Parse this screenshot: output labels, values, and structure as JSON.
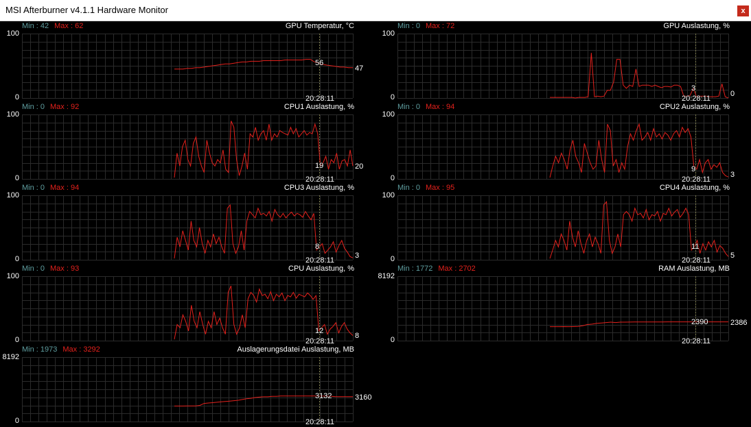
{
  "window": {
    "title": "MSI Afterburner v4.1.1 Hardware Monitor",
    "close_label": "x"
  },
  "colors": {
    "line": "#e4211c",
    "grid": "#2b2b2b",
    "min": "#5f9ea0",
    "max": "#e4211c",
    "cursor": "#7a7a4a"
  },
  "panels": [
    {
      "id": "gpu-temp",
      "title": "GPU Temperatur, °C",
      "min_label": "Min : 42",
      "max_label": "Max : 62",
      "y_top": "100",
      "y_bottom": "0",
      "ymax": 100,
      "cursor_value": "56",
      "current_value": "47",
      "time": "20:28:11"
    },
    {
      "id": "gpu-usage",
      "title": "GPU Auslastung, %",
      "min_label": "Min : 0",
      "max_label": "Max : 72",
      "y_top": "100",
      "y_bottom": "0",
      "ymax": 100,
      "cursor_value": "3",
      "current_value": "0",
      "time": "20:28:11"
    },
    {
      "id": "cpu1-usage",
      "title": "CPU1 Auslastung, %",
      "min_label": "Min : 0",
      "max_label": "Max : 92",
      "y_top": "100",
      "y_bottom": "0",
      "ymax": 100,
      "cursor_value": "19",
      "current_value": "20",
      "time": "20:28:11"
    },
    {
      "id": "cpu2-usage",
      "title": "CPU2 Auslastung, %",
      "min_label": "Min : 0",
      "max_label": "Max : 94",
      "y_top": "100",
      "y_bottom": "0",
      "ymax": 100,
      "cursor_value": "9",
      "current_value": "3",
      "time": "20:28:11"
    },
    {
      "id": "cpu3-usage",
      "title": "CPU3 Auslastung, %",
      "min_label": "Min : 0",
      "max_label": "Max : 94",
      "y_top": "100",
      "y_bottom": "0",
      "ymax": 100,
      "cursor_value": "8",
      "current_value": "3",
      "time": "20:28:11"
    },
    {
      "id": "cpu4-usage",
      "title": "CPU4 Auslastung, %",
      "min_label": "Min : 0",
      "max_label": "Max : 95",
      "y_top": "100",
      "y_bottom": "0",
      "ymax": 100,
      "cursor_value": "11",
      "current_value": "5",
      "time": "20:28:11"
    },
    {
      "id": "cpu-usage",
      "title": "CPU Auslastung, %",
      "min_label": "Min : 0",
      "max_label": "Max : 93",
      "y_top": "100",
      "y_bottom": "0",
      "ymax": 100,
      "cursor_value": "12",
      "current_value": "8",
      "time": "20:28:11"
    },
    {
      "id": "ram-usage",
      "title": "RAM Auslastung, MB",
      "min_label": "Min : 1772",
      "max_label": "Max : 2702",
      "y_top": "8192",
      "y_bottom": "0",
      "ymax": 8192,
      "cursor_value": "2390",
      "current_value": "2386",
      "time": "20:28:11"
    },
    {
      "id": "pagefile-usage",
      "title": "Auslagerungsdatei Auslastung, MB",
      "min_label": "Min : 1973",
      "max_label": "Max : 3292",
      "y_top": "8192",
      "y_bottom": "0",
      "ymax": 8192,
      "cursor_value": "3132",
      "current_value": "3160",
      "time": "20:28:11"
    }
  ],
  "chart_data": [
    {
      "type": "line",
      "title": "GPU Temperatur, °C",
      "ylim": [
        0,
        100
      ],
      "series": [
        {
          "values": [
            45,
            45,
            45,
            46,
            46,
            47,
            47,
            48,
            49,
            50,
            51,
            52,
            53,
            53,
            54,
            55,
            56,
            56,
            57,
            57,
            57,
            58,
            58,
            58,
            58,
            58,
            59,
            59,
            59,
            59,
            59,
            60,
            60,
            56,
            54,
            52,
            51,
            50,
            49,
            48,
            48,
            47,
            47
          ]
        }
      ]
    },
    {
      "type": "line",
      "title": "GPU Auslastung, %",
      "ylim": [
        0,
        100
      ],
      "series": [
        {
          "values": [
            1,
            1,
            1,
            1,
            1,
            1,
            1,
            1,
            0,
            1,
            1,
            1,
            2,
            70,
            2,
            3,
            2,
            3,
            12,
            12,
            25,
            60,
            60,
            20,
            15,
            20,
            18,
            45,
            18,
            20,
            20,
            20,
            18,
            20,
            18,
            16,
            18,
            18,
            17,
            20,
            20,
            18,
            3,
            3,
            4,
            15,
            2,
            3,
            3,
            3,
            2,
            2,
            2,
            3,
            22,
            2,
            0
          ]
        }
      ]
    },
    {
      "type": "line",
      "title": "CPU1 Auslastung, %",
      "ylim": [
        0,
        100
      ],
      "series": [
        {
          "values": [
            2,
            40,
            20,
            50,
            60,
            30,
            20,
            55,
            65,
            35,
            20,
            10,
            60,
            40,
            25,
            20,
            30,
            25,
            45,
            15,
            10,
            90,
            80,
            30,
            5,
            20,
            40,
            15,
            70,
            65,
            80,
            60,
            70,
            75,
            60,
            85,
            60,
            70,
            65,
            75,
            72,
            70,
            68,
            80,
            70,
            78,
            65,
            70,
            75,
            68,
            72,
            70,
            85,
            70,
            20,
            25,
            35,
            15,
            30,
            25,
            40,
            15,
            28,
            30,
            20,
            45,
            20
          ]
        }
      ]
    },
    {
      "type": "line",
      "title": "CPU2 Auslastung, %",
      "ylim": [
        0,
        100
      ],
      "series": [
        {
          "values": [
            2,
            20,
            35,
            25,
            40,
            30,
            15,
            45,
            60,
            35,
            25,
            10,
            55,
            40,
            25,
            15,
            20,
            60,
            30,
            10,
            85,
            75,
            20,
            30,
            10,
            25,
            15,
            50,
            70,
            60,
            75,
            85,
            60,
            65,
            72,
            60,
            78,
            65,
            70,
            62,
            72,
            68,
            60,
            70,
            75,
            65,
            80,
            72,
            78,
            65,
            20,
            15,
            30,
            10,
            25,
            30,
            15,
            22,
            18,
            25,
            10,
            5,
            3
          ]
        }
      ]
    },
    {
      "type": "line",
      "title": "CPU3 Auslastung, %",
      "ylim": [
        0,
        100
      ],
      "series": [
        {
          "values": [
            2,
            35,
            20,
            45,
            30,
            15,
            60,
            30,
            20,
            50,
            25,
            10,
            30,
            20,
            40,
            25,
            35,
            20,
            10,
            80,
            85,
            25,
            10,
            20,
            45,
            15,
            60,
            75,
            70,
            65,
            80,
            70,
            72,
            68,
            75,
            60,
            78,
            70,
            66,
            72,
            65,
            70,
            74,
            68,
            72,
            70,
            66,
            75,
            68,
            62,
            72,
            15,
            20,
            25,
            10,
            15,
            20,
            28,
            12,
            22,
            30,
            18,
            12,
            5,
            3
          ]
        }
      ]
    },
    {
      "type": "line",
      "title": "CPU4 Auslastung, %",
      "ylim": [
        0,
        100
      ],
      "series": [
        {
          "values": [
            2,
            15,
            30,
            20,
            40,
            30,
            15,
            60,
            35,
            20,
            45,
            25,
            10,
            30,
            40,
            20,
            35,
            25,
            10,
            85,
            90,
            30,
            10,
            20,
            40,
            20,
            70,
            75,
            70,
            60,
            80,
            70,
            72,
            65,
            78,
            62,
            70,
            68,
            75,
            60,
            72,
            70,
            80,
            68,
            74,
            78,
            66,
            72,
            80,
            70,
            15,
            20,
            30,
            10,
            25,
            15,
            28,
            20,
            30,
            12,
            22,
            18,
            10,
            5
          ]
        }
      ]
    },
    {
      "type": "line",
      "title": "CPU Auslastung, %",
      "ylim": [
        0,
        100
      ],
      "series": [
        {
          "values": [
            2,
            25,
            20,
            40,
            30,
            15,
            55,
            30,
            20,
            45,
            25,
            10,
            30,
            20,
            45,
            25,
            35,
            20,
            10,
            75,
            85,
            25,
            10,
            20,
            40,
            20,
            65,
            75,
            70,
            60,
            80,
            70,
            72,
            65,
            76,
            62,
            72,
            68,
            74,
            62,
            70,
            68,
            75,
            66,
            72,
            70,
            68,
            74,
            70,
            64,
            70,
            15,
            20,
            25,
            10,
            18,
            22,
            28,
            12,
            22,
            28,
            18,
            12,
            8
          ]
        }
      ]
    },
    {
      "type": "line",
      "title": "RAM Auslastung, MB",
      "ylim": [
        0,
        8192
      ],
      "series": [
        {
          "values": [
            1780,
            1780,
            1780,
            1790,
            1775,
            1790,
            1800,
            1900,
            2050,
            2100,
            2200,
            2250,
            2300,
            2350,
            2300,
            2350,
            2350,
            2360,
            2370,
            2370,
            2370,
            2380,
            2380,
            2380,
            2380,
            2385,
            2385,
            2390,
            2390,
            2390,
            2390,
            2390,
            2390,
            2390,
            2386,
            2386,
            2386,
            2386,
            2386
          ]
        }
      ]
    },
    {
      "type": "line",
      "title": "Auslagerungsdatei Auslastung, MB",
      "ylim": [
        0,
        8192
      ],
      "series": [
        {
          "values": [
            1973,
            1973,
            1973,
            1980,
            1980,
            1990,
            2050,
            2300,
            2350,
            2400,
            2450,
            2500,
            2550,
            2600,
            2650,
            2700,
            2800,
            2900,
            2950,
            3050,
            3100,
            3150,
            3150,
            3200,
            3200,
            3250,
            3250,
            3250,
            3250,
            3250,
            3240,
            3240,
            3240,
            3240,
            3235,
            3235,
            3230,
            3200,
            3160,
            3160,
            3160,
            3160,
            3160
          ]
        }
      ]
    }
  ]
}
